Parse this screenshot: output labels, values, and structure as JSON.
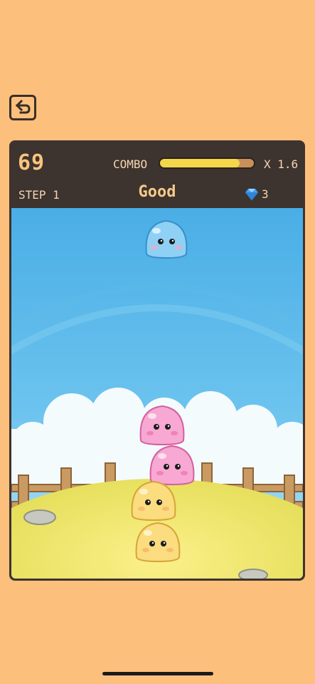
{
  "score": "69",
  "combo": {
    "label": "COMBO",
    "progress": 0.85,
    "multiplier": "X 1.6"
  },
  "step": "STEP 1",
  "rating": "Good",
  "gems": "3",
  "colors": {
    "background": "#FDC07C",
    "frame": "#3D332F",
    "accent": "#F9C47D",
    "combo_fill": "#F4D64A"
  },
  "icons": {
    "back": "undo-arrow-icon",
    "gem": "diamond-icon"
  },
  "blobs": [
    {
      "name": "blue-blob-falling",
      "color": "blue"
    },
    {
      "name": "pink-blob-top",
      "color": "pink"
    },
    {
      "name": "pink-blob-second",
      "color": "pink"
    },
    {
      "name": "yellow-blob-third",
      "color": "yellow"
    },
    {
      "name": "yellow-blob-bottom",
      "color": "yellow"
    }
  ]
}
